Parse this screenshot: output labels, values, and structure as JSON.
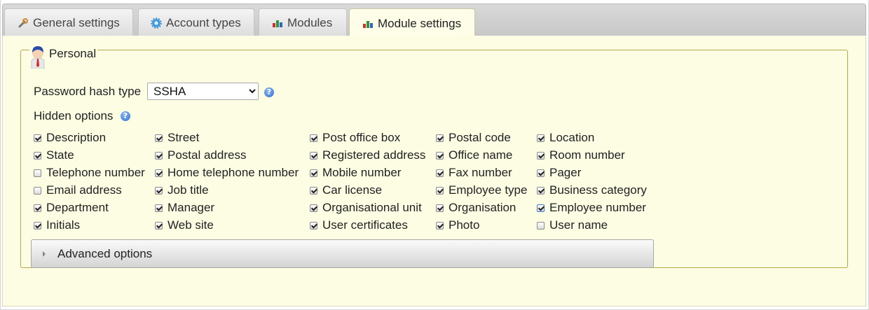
{
  "tabs": [
    {
      "label": "General settings",
      "icon": "wrench-icon"
    },
    {
      "label": "Account types",
      "icon": "gear-icon"
    },
    {
      "label": "Modules",
      "icon": "modules-icon"
    },
    {
      "label": "Module settings",
      "icon": "modules-icon",
      "active": true
    }
  ],
  "section": {
    "legend": "Personal",
    "icon": "user-icon"
  },
  "password_hash": {
    "label": "Password hash type",
    "value": "SSHA",
    "options": [
      "SSHA"
    ]
  },
  "hidden_options": {
    "label": "Hidden options",
    "columns": [
      [
        {
          "label": "Description",
          "checked": true
        },
        {
          "label": "State",
          "checked": true
        },
        {
          "label": "Telephone number",
          "checked": false
        },
        {
          "label": "Email address",
          "checked": false
        },
        {
          "label": "Department",
          "checked": true
        },
        {
          "label": "Initials",
          "checked": true
        }
      ],
      [
        {
          "label": "Street",
          "checked": true
        },
        {
          "label": "Postal address",
          "checked": true
        },
        {
          "label": "Home telephone number",
          "checked": true
        },
        {
          "label": "Job title",
          "checked": true
        },
        {
          "label": "Manager",
          "checked": true
        },
        {
          "label": "Web site",
          "checked": true
        }
      ],
      [
        {
          "label": "Post office box",
          "checked": true
        },
        {
          "label": "Registered address",
          "checked": true
        },
        {
          "label": "Mobile number",
          "checked": true
        },
        {
          "label": "Car license",
          "checked": true
        },
        {
          "label": "Organisational unit",
          "checked": true
        },
        {
          "label": "User certificates",
          "checked": true
        }
      ],
      [
        {
          "label": "Postal code",
          "checked": true
        },
        {
          "label": "Office name",
          "checked": true
        },
        {
          "label": "Fax number",
          "checked": true
        },
        {
          "label": "Employee type",
          "checked": true
        },
        {
          "label": "Organisation",
          "checked": true
        },
        {
          "label": "Photo",
          "checked": true
        }
      ],
      [
        {
          "label": "Location",
          "checked": true
        },
        {
          "label": "Room number",
          "checked": true
        },
        {
          "label": "Pager",
          "checked": true
        },
        {
          "label": "Business category",
          "checked": true
        },
        {
          "label": "Employee number",
          "checked": true
        },
        {
          "label": "User name",
          "checked": false
        }
      ]
    ]
  },
  "advanced": {
    "label": "Advanced options"
  },
  "colors": {
    "panel_bg": "#fdfde4",
    "fieldset_border": "#b6a74a",
    "help_blue": "#2f6fd0"
  }
}
